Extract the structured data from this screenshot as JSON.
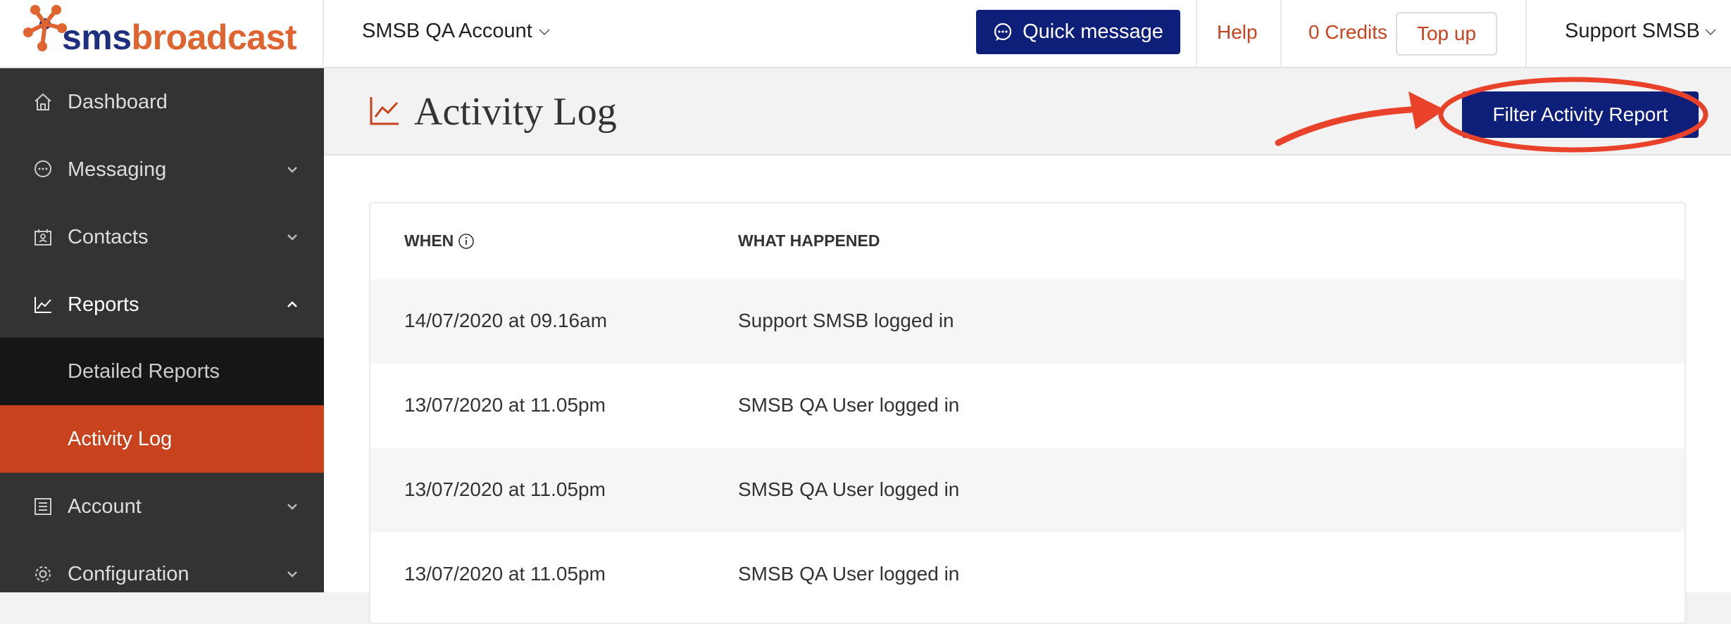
{
  "header": {
    "brand": {
      "sms": "sms",
      "broadcast": "broadcast"
    },
    "account_name": "SMSB QA Account",
    "quick_message_label": "Quick message",
    "help_label": "Help",
    "credits_label": "0 Credits",
    "topup_label": "Top up",
    "user_label": "Support SMSB"
  },
  "sidebar": {
    "items": [
      {
        "label": "Dashboard",
        "icon": "home-icon"
      },
      {
        "label": "Messaging",
        "icon": "chat-icon"
      },
      {
        "label": "Contacts",
        "icon": "contacts-icon"
      },
      {
        "label": "Reports",
        "icon": "chart-icon",
        "expanded": true
      },
      {
        "label": "Account",
        "icon": "list-icon"
      },
      {
        "label": "Configuration",
        "icon": "gear-icon"
      }
    ],
    "sub_items": [
      {
        "label": "Detailed Reports"
      },
      {
        "label": "Activity Log",
        "active": true
      }
    ]
  },
  "page": {
    "title": "Activity Log",
    "filter_button_label": "Filter Activity Report"
  },
  "table": {
    "columns": [
      "WHEN",
      "WHAT HAPPENED"
    ],
    "rows": [
      {
        "when": "14/07/2020 at 09.16am",
        "what": "Support SMSB logged in"
      },
      {
        "when": "13/07/2020 at 11.05pm",
        "what": "SMSB QA User logged in"
      },
      {
        "when": "13/07/2020 at 11.05pm",
        "what": "SMSB QA User logged in"
      },
      {
        "when": "13/07/2020 at 11.05pm",
        "what": "SMSB QA User logged in"
      }
    ]
  },
  "colors": {
    "brand_navy": "#0e1f7a",
    "brand_orange": "#c8421d",
    "sidebar_bg": "#333333",
    "annotation_red": "#e8432a"
  }
}
